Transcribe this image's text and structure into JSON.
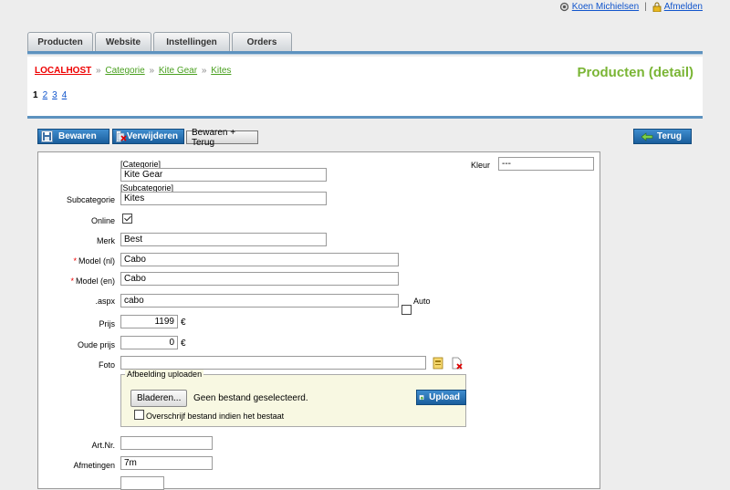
{
  "user": {
    "name": "Koen Michielsen",
    "logout": "Afmelden"
  },
  "tabs": [
    "Producten",
    "Website",
    "Instellingen",
    "Orders"
  ],
  "breadcrumb": {
    "root": "LOCALHOST",
    "sep": "»",
    "items": [
      "Categorie",
      "Kite Gear",
      "Kites"
    ]
  },
  "page_title": "Producten (detail)",
  "pager": [
    "1",
    "2",
    "3",
    "4"
  ],
  "toolbar": {
    "save": "Bewaren",
    "delete": "Verwijderen",
    "save_back": "Bewaren + Terug",
    "back": "Terug"
  },
  "form": {
    "categorie_label": "[Categorie]",
    "categorie_value": "Kite Gear",
    "subcategorie_top_label": "[Subcategorie]",
    "subcategorie_label": "Subcategorie",
    "subcategorie_value": "Kites",
    "kleur_label": "Kleur",
    "kleur_value": "---",
    "online_label": "Online",
    "merk_label": "Merk",
    "merk_value": "Best",
    "req_mark": "*",
    "model_nl_label": "Model (nl)",
    "model_nl_value": "Cabo",
    "model_en_label": "Model (en)",
    "model_en_value": "Cabo",
    "aspx_label": ".aspx",
    "aspx_value": "cabo",
    "auto_label": "Auto",
    "prijs_label": "Prijs",
    "prijs_value": "1199",
    "currency": "€",
    "oude_prijs_label": "Oude prijs",
    "oude_prijs_value": "0",
    "foto_label": "Foto",
    "upload_legend": "Afbeelding uploaden",
    "browse_label": "Bladeren...",
    "no_file": "Geen bestand geselecteerd.",
    "upload_button": "Upload",
    "overwrite_label": "Overschrijf bestand indien het bestaat",
    "artnr_label": "Art.Nr.",
    "afmetingen_label": "Afmetingen",
    "afmetingen_value": "7m"
  },
  "colors": {
    "accent_blue": "#1a5e9c",
    "title_green": "#7ab535",
    "required_red": "#e00000"
  }
}
